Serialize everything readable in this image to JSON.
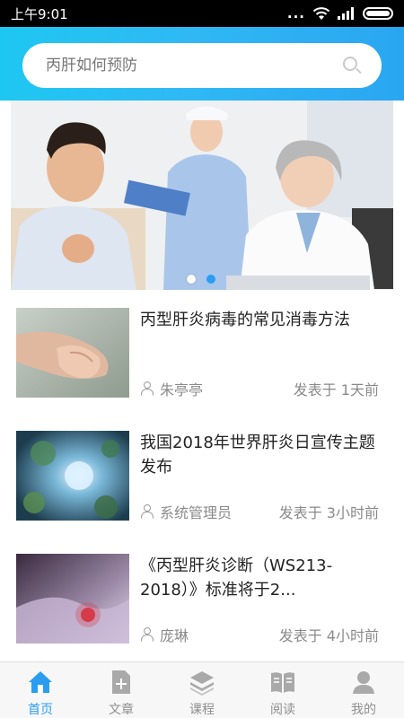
{
  "status_bar": {
    "time": "上午9:01",
    "dots": "..."
  },
  "search": {
    "placeholder": "丙肝如何预防"
  },
  "banner": {
    "active_index": 1,
    "count": 2
  },
  "articles": [
    {
      "title": "丙型肝炎病毒的常见消毒方法",
      "author": "朱亭亭",
      "time": "发表于 1天前",
      "thumb": "hands-photo"
    },
    {
      "title": "我国2018年世界肝炎日宣传主题发布",
      "author": "系统管理员",
      "time": "发表于 3小时前",
      "thumb": "virus-blue-photo"
    },
    {
      "title": "《丙型肝炎诊断（WS213-2018）》标准将于2...",
      "author": "庞琳",
      "time": "发表于 4小时前",
      "thumb": "virus-purple-photo"
    }
  ],
  "tabs": [
    {
      "label": "首页",
      "icon": "home-icon",
      "active": true
    },
    {
      "label": "文章",
      "icon": "document-add-icon",
      "active": false
    },
    {
      "label": "课程",
      "icon": "layers-icon",
      "active": false
    },
    {
      "label": "阅读",
      "icon": "book-icon",
      "active": false
    },
    {
      "label": "我的",
      "icon": "person-icon",
      "active": false
    }
  ],
  "colors": {
    "accent": "#2a9df0",
    "header_start": "#1ec7f2",
    "header_end": "#2aa6f1"
  }
}
